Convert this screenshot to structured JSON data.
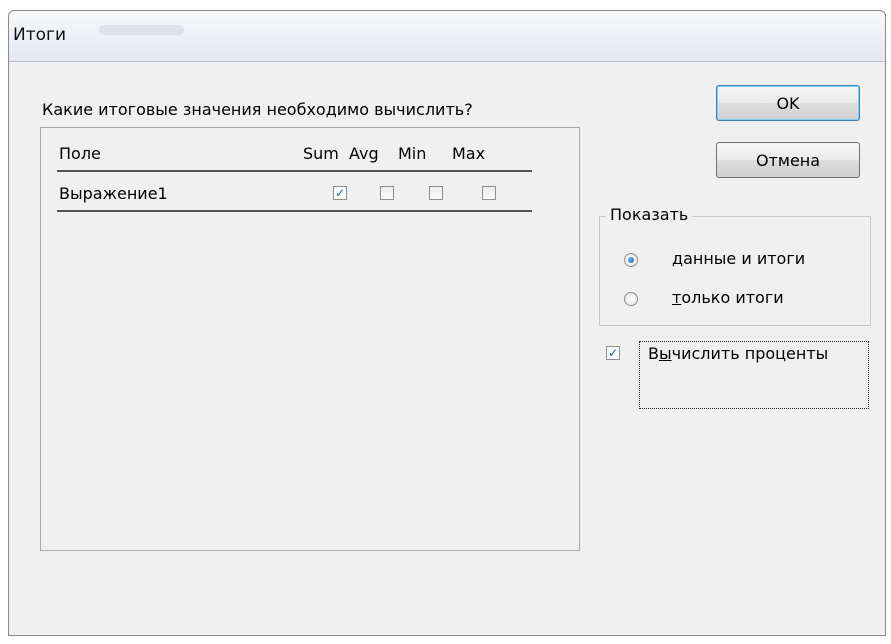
{
  "window": {
    "title": "Итоги"
  },
  "dialog": {
    "question": "Какие итоговые значения необходимо вычислить?",
    "columns": {
      "field": "Поле",
      "sum": "Sum",
      "avg": "Avg",
      "min": "Min",
      "max": "Max"
    },
    "rows": [
      {
        "field": "Выражение1",
        "sum": true,
        "avg": false,
        "min": false,
        "max": false
      }
    ]
  },
  "buttons": {
    "ok": "OK",
    "cancel": "Отмена"
  },
  "show_group": {
    "title": "Показать",
    "options": [
      {
        "accel": "д",
        "rest": "анные и итоги",
        "selected": true
      },
      {
        "accel": "т",
        "rest": "олько итоги",
        "selected": false
      }
    ]
  },
  "calc_percent": {
    "accel": "ы",
    "pre": "В",
    "rest": "числить проценты",
    "checked": true
  },
  "glyphs": {
    "check": "✓"
  },
  "colors": {
    "accent": "#2a5ca8",
    "default_button_border": "#3c7fb1"
  }
}
